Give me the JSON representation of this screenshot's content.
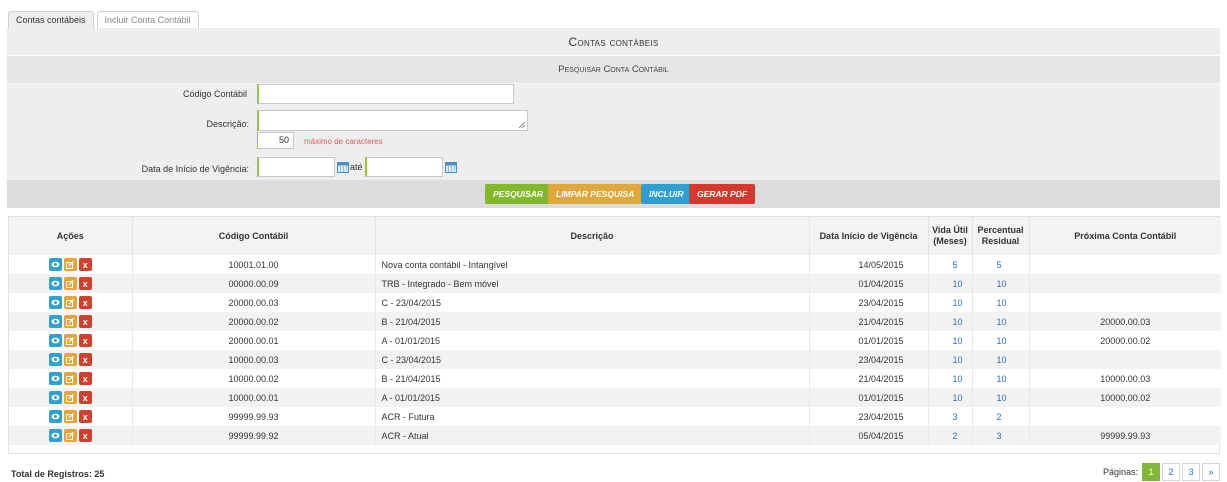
{
  "tabs": [
    {
      "label": "Contas contábeis"
    },
    {
      "label": "Incluir Conta Contábil"
    }
  ],
  "panel": {
    "title": "Contas contábeis",
    "subtitle": "Pesquisar Conta Contábil"
  },
  "form": {
    "codigo_label": "Código Contábil",
    "codigo_value": "",
    "descricao_label": "Descrição:",
    "descricao_value": "",
    "char_count": "50",
    "char_msg": "máximo de caracteres",
    "data_label": "Data de Início de Vigência:",
    "data_inicio_value": "",
    "ate_label": "até",
    "data_fim_value": ""
  },
  "buttons": {
    "pesquisar": "Pesquisar",
    "limpar": "Limpar Pesquisa",
    "incluir": "Incluir",
    "gerar_pdf": "Gerar PDF"
  },
  "colors": {
    "view": "#2ea3cf",
    "edit": "#e7a43a",
    "delete": "#d0402f",
    "link": "#2a6fc4",
    "active_page": "#84b637"
  },
  "table": {
    "headers": {
      "acoes": "Ações",
      "codigo": "Código Contábil",
      "descricao": "Descrição",
      "data": "Data Início de Vigência",
      "vida_l1": "Vida Útil",
      "vida_l2": "(Meses)",
      "perc_l1": "Percentual",
      "perc_l2": "Residual",
      "proxima": "Próxima Conta Contábil"
    },
    "action_icons": [
      "eye-icon",
      "edit-icon",
      "delete-icon"
    ],
    "rows": [
      {
        "codigo": "10001.01.00",
        "descricao": "Nova conta contábil - Intangível",
        "data": "14/05/2015",
        "vida": "5",
        "perc": "5",
        "proxima": ""
      },
      {
        "codigo": "00000.00.09",
        "descricao": "TRB - Integrado - Bem móvel",
        "data": "01/04/2015",
        "vida": "10",
        "perc": "10",
        "proxima": ""
      },
      {
        "codigo": "20000.00.03",
        "descricao": "C - 23/04/2015",
        "data": "23/04/2015",
        "vida": "10",
        "perc": "10",
        "proxima": ""
      },
      {
        "codigo": "20000.00.02",
        "descricao": "B - 21/04/2015",
        "data": "21/04/2015",
        "vida": "10",
        "perc": "10",
        "proxima": "20000.00.03"
      },
      {
        "codigo": "20000.00.01",
        "descricao": "A - 01/01/2015",
        "data": "01/01/2015",
        "vida": "10",
        "perc": "10",
        "proxima": "20000.00.02"
      },
      {
        "codigo": "10000.00.03",
        "descricao": "C - 23/04/2015",
        "data": "23/04/2015",
        "vida": "10",
        "perc": "10",
        "proxima": ""
      },
      {
        "codigo": "10000.00.02",
        "descricao": "B - 21/04/2015",
        "data": "21/04/2015",
        "vida": "10",
        "perc": "10",
        "proxima": "10000.00.03"
      },
      {
        "codigo": "10000.00.01",
        "descricao": "A - 01/01/2015",
        "data": "01/01/2015",
        "vida": "10",
        "perc": "10",
        "proxima": "10000.00.02"
      },
      {
        "codigo": "99999.99.93",
        "descricao": "ACR - Futura",
        "data": "23/04/2015",
        "vida": "3",
        "perc": "2",
        "proxima": ""
      },
      {
        "codigo": "99999.99.92",
        "descricao": "ACR - Atual",
        "data": "05/04/2015",
        "vida": "2",
        "perc": "3",
        "proxima": "99999.99.93"
      }
    ]
  },
  "footer": {
    "total": "Total de Registros: 25",
    "paginas_label": "Páginas:",
    "pages": [
      "1",
      "2",
      "3"
    ],
    "next": "»"
  }
}
